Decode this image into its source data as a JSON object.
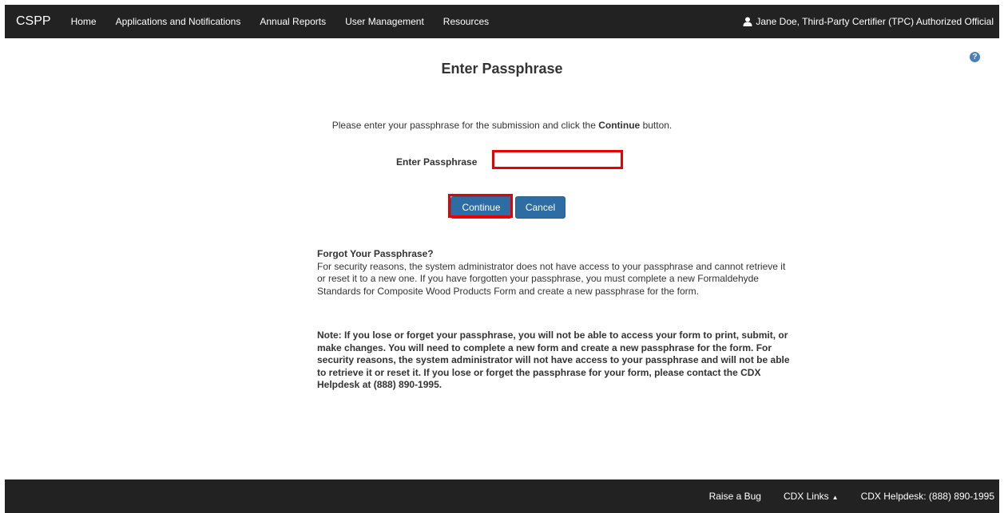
{
  "navbar": {
    "brand": "CSPP",
    "items": [
      {
        "label": "Home"
      },
      {
        "label": "Applications and Notifications"
      },
      {
        "label": "Annual Reports"
      },
      {
        "label": "User Management"
      },
      {
        "label": "Resources"
      }
    ],
    "user": "Jane Doe, Third-Party Certifier (TPC) Authorized Official"
  },
  "help_icon_glyph": "?",
  "page": {
    "title": "Enter Passphrase",
    "instruction_prefix": "Please enter your passphrase for the submission and click the ",
    "instruction_bold": "Continue",
    "instruction_suffix": " button.",
    "pass_label": "Enter Passphrase",
    "pass_value": "",
    "continue_label": "Continue",
    "cancel_label": "Cancel"
  },
  "forgot": {
    "title": "Forgot Your Passphrase?",
    "body": "For security reasons, the system administrator does not have access to your passphrase and cannot retrieve it or reset it to a new one. If you have forgotten your passphrase, you must complete a new Formaldehyde Standards for Composite Wood Products Form and create a new passphrase for the form.",
    "note": "Note: If you lose or forget your passphrase, you will not be able to access your form to print, submit, or make changes. You will need to complete a new form and create a new passphrase for the form. For security reasons, the system administrator will not have access to your passphrase and will not be able to retrieve it or reset it. If you lose or forget the passphrase for your form, please contact the CDX Helpdesk at (888) 890-1995."
  },
  "footer": {
    "raise_bug": "Raise a Bug",
    "cdx_links": "CDX Links",
    "caret": "▲",
    "helpdesk": "CDX Helpdesk: (888) 890-1995"
  },
  "colors": {
    "navbar_bg": "#222222",
    "button_bg": "#2e6da4",
    "highlight": "#e60000",
    "help_icon": "#4a7fb8"
  }
}
